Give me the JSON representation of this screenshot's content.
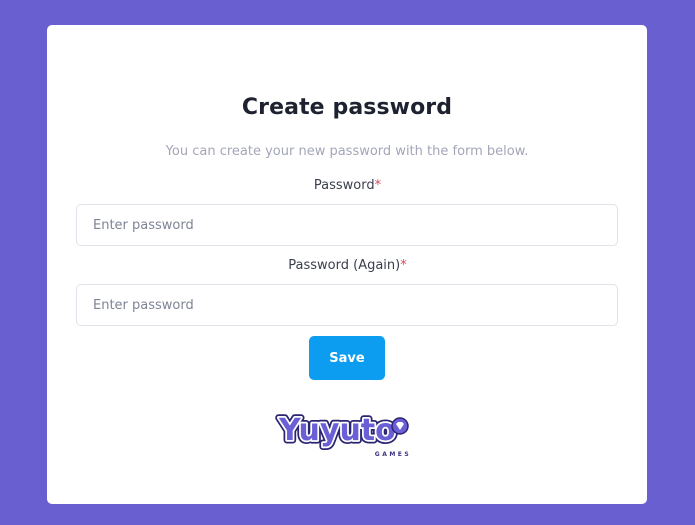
{
  "form": {
    "title": "Create password",
    "subtitle": "You can create your new password with the form below.",
    "password_label": "Password",
    "password_placeholder": "Enter password",
    "password_again_label": "Password (Again)",
    "password_again_placeholder": "Enter password",
    "required_marker": "*",
    "save_label": "Save"
  },
  "logo": {
    "brand": "Yuyuto",
    "sub": "GAMES"
  },
  "colors": {
    "background": "#6a5fd0",
    "primary_button": "#0d9df0",
    "required": "#e0455f",
    "logo_purple": "#6b5fd6"
  }
}
